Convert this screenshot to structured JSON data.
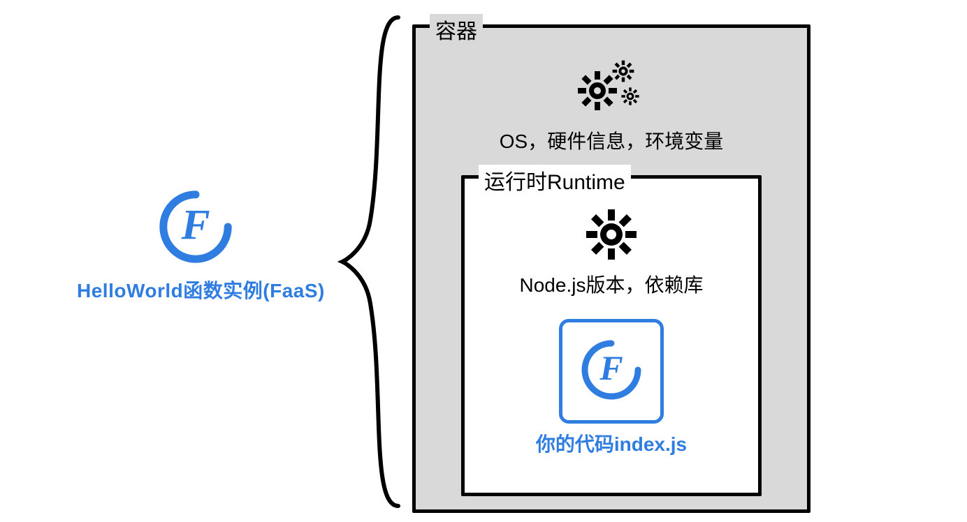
{
  "left": {
    "title": "HelloWorld函数实例(FaaS)"
  },
  "container": {
    "legend": "容器",
    "info": "OS，硬件信息，环境变量",
    "runtime": {
      "legend": "运行时Runtime",
      "info": "Node.js版本，依赖库",
      "code_label": "你的代码index.js"
    }
  },
  "icons": {
    "faas": "F-logo",
    "gears": "gears-icon",
    "gear": "gear-icon"
  },
  "colors": {
    "accent": "#2f7de1",
    "container_bg": "#d9d9d9"
  }
}
